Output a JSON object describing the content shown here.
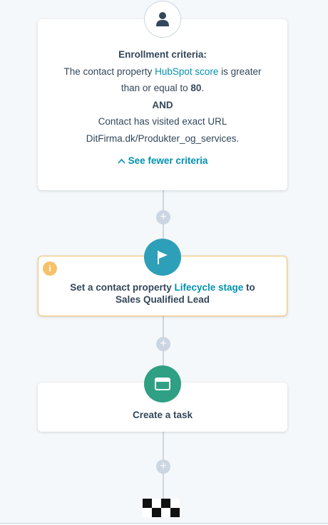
{
  "enrollment": {
    "heading": "Enrollment criteria:",
    "line1_prefix": "The contact property ",
    "line1_link": "HubSpot score",
    "line1_suffix": " is greater",
    "line2_prefix": "than or equal to ",
    "line2_value": "80",
    "line2_suffix": ".",
    "and_label": "AND",
    "line3": "Contact has visited exact URL",
    "url": "DitFirma.dk/Produkter_og_services.",
    "toggle_label": "See fewer criteria"
  },
  "set_property": {
    "prefix": "Set a contact property ",
    "link": "Lifecycle stage",
    "suffix": " to",
    "line2": "Sales Qualified Lead",
    "warning_icon": "info-icon"
  },
  "task": {
    "label": "Create a task"
  },
  "plus_label": "+",
  "warning_glyph": "i",
  "icons": {
    "trigger": "contact-person-icon",
    "set_property": "flag-icon",
    "task": "task-icon",
    "end": "checkered-flag-icon"
  },
  "colors": {
    "accent": "#0091ae",
    "flag_circle": "#2e9fb9",
    "task_circle": "#2fa084",
    "warning": "#f5c26b",
    "connector": "#cbd6e2"
  }
}
